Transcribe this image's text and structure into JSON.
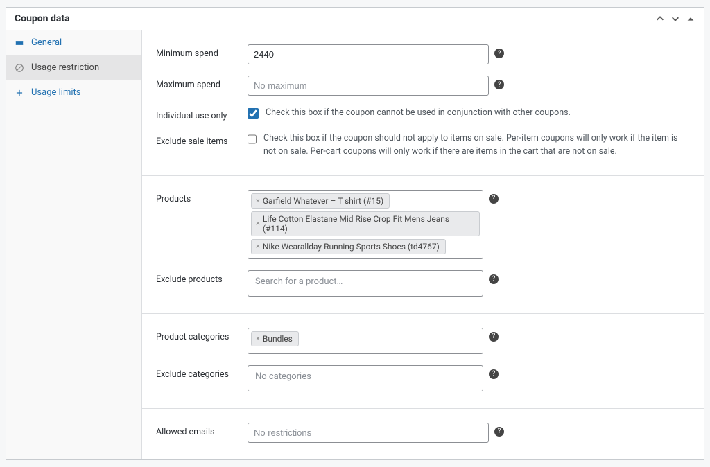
{
  "header": {
    "title": "Coupon data"
  },
  "tabs": {
    "general": "General",
    "usage_restriction": "Usage restriction",
    "usage_limits": "Usage limits"
  },
  "fields": {
    "min_spend": {
      "label": "Minimum spend",
      "value": "2440"
    },
    "max_spend": {
      "label": "Maximum spend",
      "placeholder": "No maximum"
    },
    "individual_use": {
      "label": "Individual use only",
      "desc": "Check this box if the coupon cannot be used in conjunction with other coupons."
    },
    "exclude_sale": {
      "label": "Exclude sale items",
      "desc": "Check this box if the coupon should not apply to items on sale. Per-item coupons will only work if the item is not on sale. Per-cart coupons will only work if there are items in the cart that are not on sale."
    },
    "products": {
      "label": "Products",
      "tags": [
        "Garfield Whatever – T shirt (#15)",
        "Life Cotton Elastane Mid Rise Crop Fit Mens Jeans (#114)",
        "Nike Wearallday Running Sports Shoes (td4767)"
      ]
    },
    "exclude_products": {
      "label": "Exclude products",
      "placeholder": "Search for a product…"
    },
    "product_categories": {
      "label": "Product categories",
      "tags": [
        "Bundles"
      ]
    },
    "exclude_categories": {
      "label": "Exclude categories",
      "placeholder": "No categories"
    },
    "allowed_emails": {
      "label": "Allowed emails",
      "placeholder": "No restrictions"
    }
  }
}
